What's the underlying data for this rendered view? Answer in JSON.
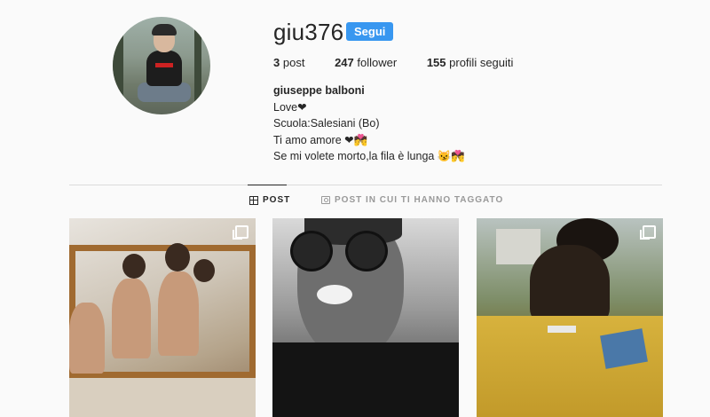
{
  "profile": {
    "username": "giu376",
    "follow_label": "Segui",
    "stats": {
      "posts_count": "3",
      "posts_label": "post",
      "followers_count": "247",
      "followers_label": "follower",
      "following_count": "155",
      "following_label": "profili seguiti"
    },
    "bio": {
      "name": "giuseppe balboni",
      "lines": [
        "Love❤",
        "Scuola:Salesiani (Bo)",
        "Ti amo amore ❤💏",
        "Se mi volete morto,la fila è lunga 😼💏"
      ]
    }
  },
  "tabs": {
    "posts_label": "POST",
    "tagged_label": "POST IN CUI TI HANNO TAGGATO"
  },
  "icons": {
    "grid": "grid-icon",
    "tagged": "tagged-icon",
    "multi_photo": "multi-photo-icon"
  },
  "colors": {
    "accent": "#3897f0",
    "background": "#fafafa",
    "text": "#262626",
    "muted": "#999999",
    "divider": "#dbdbdb"
  }
}
